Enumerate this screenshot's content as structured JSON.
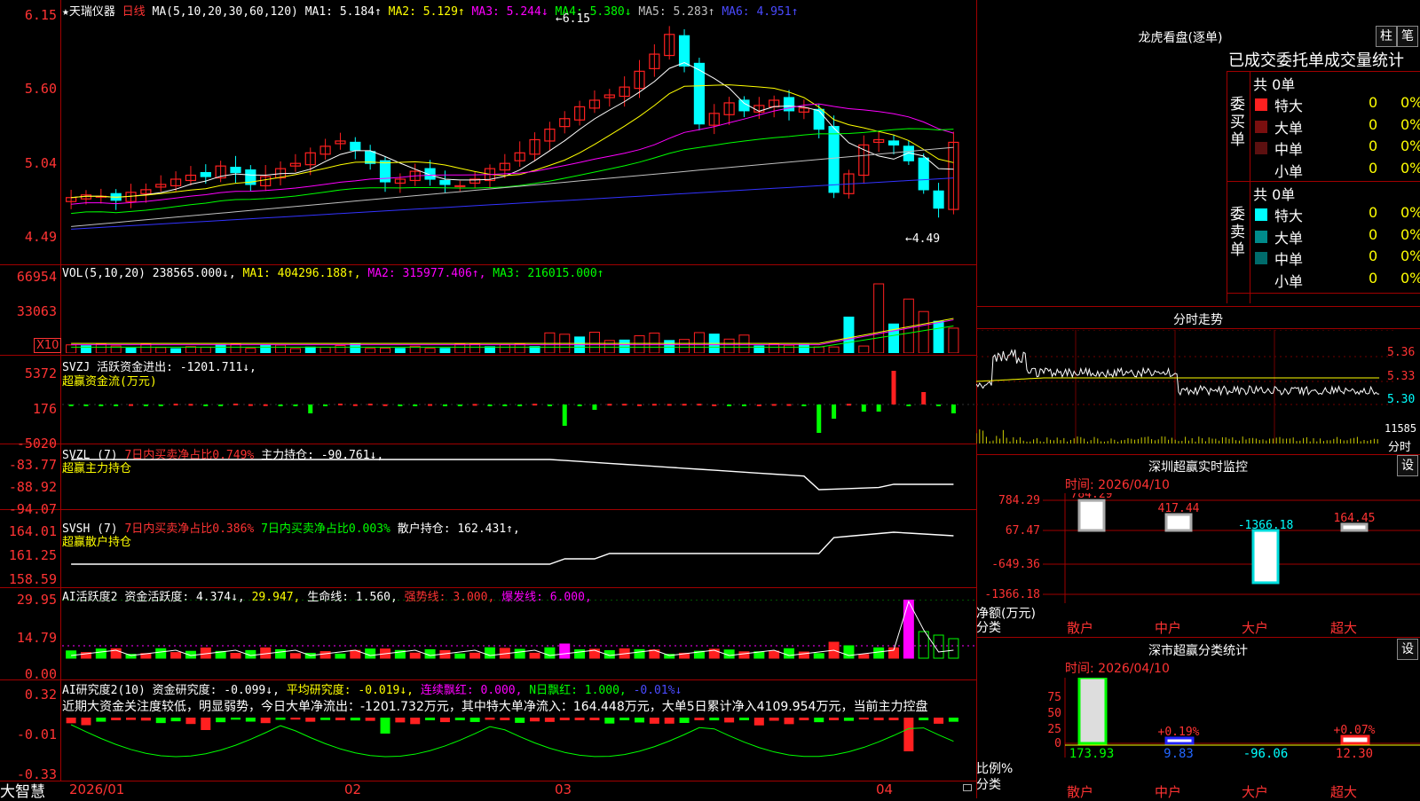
{
  "price_panel": {
    "stock_name": "★天瑞仪器",
    "period": "日线",
    "ma_label": "MA(5,10,20,30,60,120)",
    "ma1": "MA1: 5.184↑",
    "ma2": "MA2: 5.129↑",
    "ma3": "MA3: 5.244↓",
    "ma4": "MA4: 5.380↓",
    "ma5": "MA5: 5.283↑",
    "ma6": "MA6: 4.951↑",
    "y_ticks": [
      "6.15",
      "5.60",
      "5.04",
      "4.49"
    ],
    "high_mark": "6.15",
    "low_mark": "4.49"
  },
  "vol_panel": {
    "label": "VOL(5,10,20)",
    "value": "238565.000↓,",
    "ma1": "MA1: 404296.188↑,",
    "ma2": "MA2: 315977.406↑,",
    "ma3": "MA3: 216015.000↑",
    "y_ticks": [
      "66954",
      "33063"
    ],
    "unit": "X10"
  },
  "svzj_panel": {
    "label": "SVZJ",
    "text": "活跃资金进出: -1201.711↓,",
    "subtitle": "超赢资金流(万元)",
    "y_ticks": [
      "5372",
      "176",
      "-5020"
    ]
  },
  "svzl_panel": {
    "label": "SVZL (7)",
    "text1": "7日内买卖净占比0.749%",
    "text2": "主力持仓: -90.761↓,",
    "subtitle": "超赢主力持仓",
    "y_ticks": [
      "-83.77",
      "-88.92",
      "-94.07"
    ]
  },
  "svsh_panel": {
    "label": "SVSH (7)",
    "text1": "7日内买卖净占比0.386%",
    "text2": "7日内买卖净占比0.003%",
    "text3": "散户持仓: 162.431↑,",
    "subtitle": "超赢散户持仓",
    "y_ticks": [
      "164.01",
      "161.25",
      "158.59"
    ]
  },
  "ai_active_panel": {
    "label": "AI活跃度2",
    "t1": "资金活跃度: 4.374↓,",
    "t2": "29.947,",
    "t3": "生命线: 1.560,",
    "t4": "强势线: 3.000,",
    "t5": "爆发线: 6.000,",
    "y_ticks": [
      "29.95",
      "14.79",
      "0.00"
    ]
  },
  "ai_research_panel": {
    "label": "AI研究度2(10)",
    "t1": "资金研究度: -0.099↓,",
    "t2": "平均研究度: -0.019↓,",
    "t3": "连续飘红: 0.000,",
    "t4": "N日飘红: 1.000,",
    "t5": "-0.01%↓",
    "summary": "近期大资金关注度较低，明显弱势，今日大单净流出：-1201.732万元，其中特大单净流入：164.448万元，大单5日累计净入4109.954万元，当前主力控盘",
    "y_ticks": [
      "0.32",
      "-0.01",
      "-0.33"
    ]
  },
  "x_axis": {
    "labels": [
      "2026/01",
      "02",
      "03",
      "04"
    ],
    "brand": "大智慧"
  },
  "right": {
    "lhb_title": "龙虎看盘(逐单)",
    "btn_bar": "柱",
    "btn_pen": "笔",
    "table_title": "已成交委托单成交量统计",
    "buy_side": "委买单",
    "sell_side": "委卖单",
    "buy_total": "共 0单",
    "sell_total": "共 0单",
    "buy_rows": [
      {
        "name": "特大",
        "qty": "0",
        "pct": "0%"
      },
      {
        "name": "大单",
        "qty": "0",
        "pct": "0%"
      },
      {
        "name": "中单",
        "qty": "0",
        "pct": "0%"
      },
      {
        "name": "小单",
        "qty": "0",
        "pct": "0%"
      }
    ],
    "sell_rows": [
      {
        "name": "特大",
        "qty": "0",
        "pct": "0%"
      },
      {
        "name": "大单",
        "qty": "0",
        "pct": "0%"
      },
      {
        "name": "中单",
        "qty": "0",
        "pct": "0%"
      },
      {
        "name": "小单",
        "qty": "0",
        "pct": "0%"
      }
    ],
    "intraday_title": "分时走势",
    "intraday_ticks": [
      "5.36",
      "5.33",
      "5.30",
      "11585"
    ],
    "intraday_unit": "分时",
    "monitor_title": "深圳超赢实时监控",
    "monitor_btn": "设",
    "monitor_time": "时间: 2026/04/10",
    "monitor_y": [
      "784.29",
      "67.47",
      "-649.36",
      "-1366.18"
    ],
    "monitor_values": [
      "784.29",
      "417.44",
      "-1366.18",
      "164.45"
    ],
    "monitor_ylabel": "净额(万元)",
    "monitor_xlabel": "分类",
    "categories": [
      "散户",
      "中户",
      "大户",
      "超大"
    ],
    "class_title": "深市超赢分类统计",
    "class_btn": "设",
    "class_time": "时间: 2026/04/10",
    "class_y": [
      "75",
      "50",
      "25",
      "0"
    ],
    "class_ylabel": "比例%",
    "class_xlabel": "分类",
    "class_top": [
      "+0.19%",
      "+0.07%"
    ],
    "class_values": [
      "173.93",
      "9.83",
      "-96.06",
      "12.30"
    ]
  },
  "colors": {
    "up": "#ff2020",
    "down": "#00ffff",
    "grid": "#a00000",
    "bg": "#000000"
  }
}
